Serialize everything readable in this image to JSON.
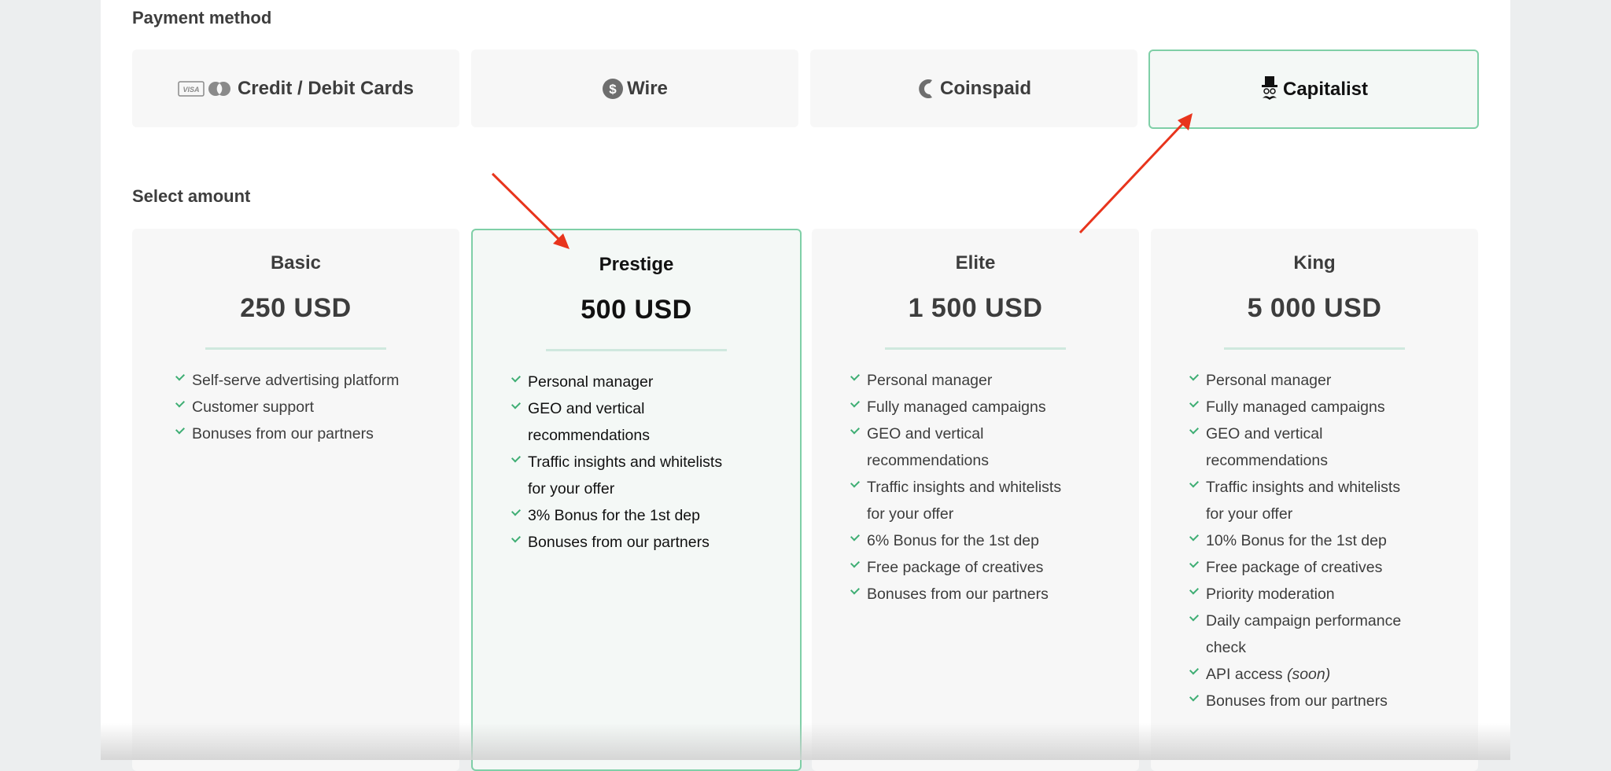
{
  "payment": {
    "title": "Payment method",
    "methods": [
      {
        "label": "Credit / Debit Cards",
        "icon": "visa-mastercard-icon",
        "icon_text": "VISA"
      },
      {
        "label": "Wire",
        "icon": "dollar-coin-icon"
      },
      {
        "label": "Coinspaid",
        "icon": "coinspaid-icon"
      },
      {
        "label": "Capitalist",
        "icon": "capitalist-top-hat-icon",
        "selected": true
      }
    ]
  },
  "amount": {
    "title": "Select amount",
    "plans": [
      {
        "name": "Basic",
        "price": "250 USD",
        "features": [
          "Self-serve advertising platform",
          "Customer support",
          "Bonuses from our partners"
        ]
      },
      {
        "name": "Prestige",
        "price": "500 USD",
        "selected": true,
        "features": [
          "Personal manager",
          "GEO and vertical recommendations",
          "Traffic insights and whitelists for your offer",
          "3% Bonus for the 1st dep",
          "Bonuses from our partners"
        ]
      },
      {
        "name": "Elite",
        "price": "1 500 USD",
        "features": [
          "Personal manager",
          "Fully managed campaigns",
          "GEO and vertical recommendations",
          "Traffic insights and whitelists for your offer",
          "6% Bonus for the 1st dep",
          "Free package of creatives",
          "Bonuses from our partners"
        ]
      },
      {
        "name": "King",
        "price": "5 000 USD",
        "features": [
          "Personal manager",
          "Fully managed campaigns",
          "GEO and vertical recommendations",
          "Traffic insights and whitelists for your offer",
          "10% Bonus for the 1st dep",
          "Free package of creatives",
          "Priority moderation",
          "Daily campaign performance check",
          "API access",
          "Bonuses from our partners"
        ],
        "api_note": "(soon)"
      }
    ]
  },
  "colors": {
    "accent_border": "#7fcfa7",
    "check": "#3fae74",
    "annotation_arrow": "#e8341c"
  }
}
